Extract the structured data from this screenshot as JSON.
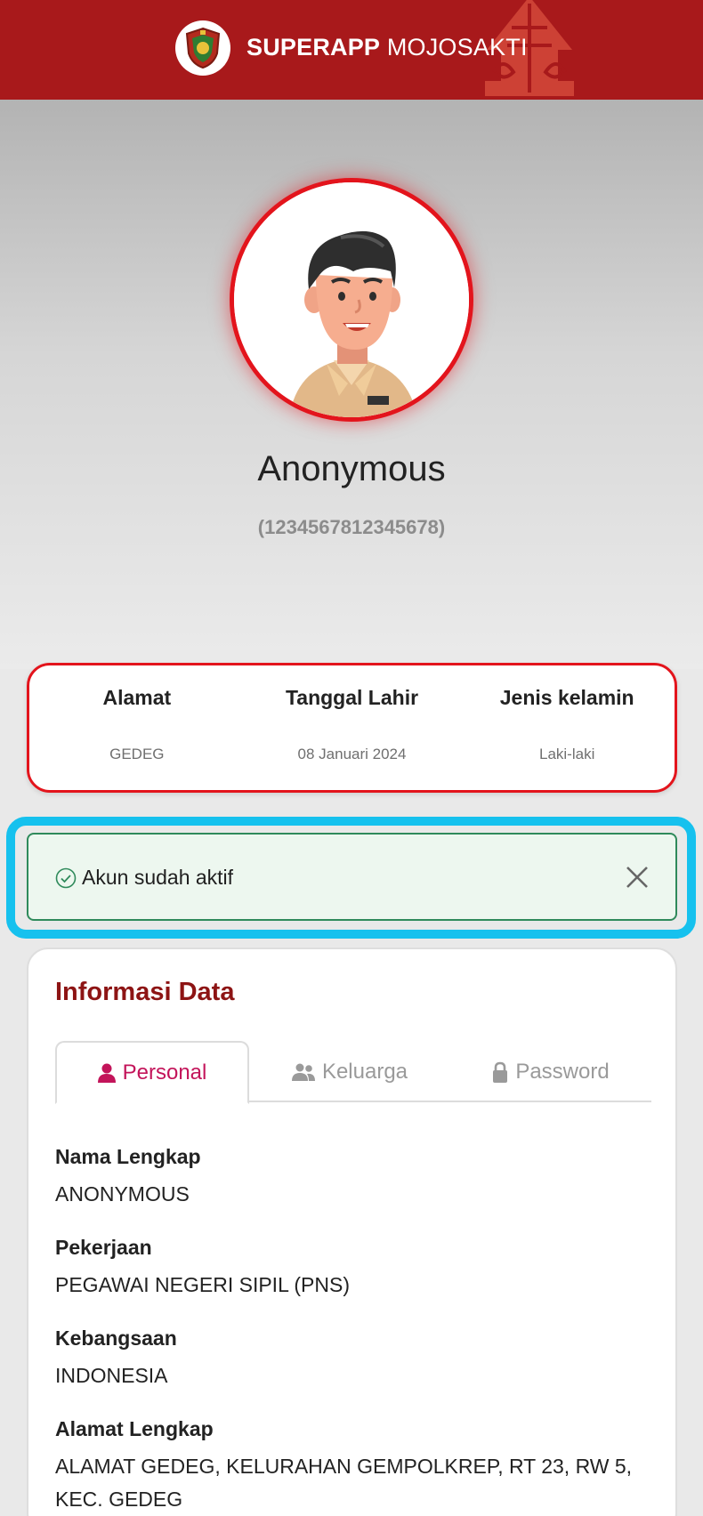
{
  "header": {
    "title_bold": "SUPERAPP",
    "title_rest": " MOJOSAKTI",
    "colors": {
      "background": "#a8191b",
      "ornament": "#d4483a"
    }
  },
  "profile": {
    "name": "Anonymous",
    "nip": "(1234567812345678)",
    "ring_color": "#e3141c"
  },
  "info": {
    "items": [
      {
        "label": "Alamat",
        "value": "GEDEG"
      },
      {
        "label": "Tanggal Lahir",
        "value": "08 Januari 2024"
      },
      {
        "label": "Jenis kelamin",
        "value": "Laki-laki"
      }
    ]
  },
  "alert": {
    "message": "Akun sudah aktif",
    "color": "#2f8a5b",
    "highlight_color": "#16c1ee"
  },
  "data_section": {
    "title": "Informasi Data",
    "tabs": [
      {
        "label": "Personal",
        "icon": "user-icon",
        "active": true
      },
      {
        "label": "Keluarga",
        "icon": "users-icon",
        "active": false
      },
      {
        "label": "Password",
        "icon": "lock-icon",
        "active": false
      }
    ],
    "fields": [
      {
        "label": "Nama Lengkap",
        "value": "ANONYMOUS"
      },
      {
        "label": "Pekerjaan",
        "value": "PEGAWAI NEGERI SIPIL (PNS)"
      },
      {
        "label": "Kebangsaan",
        "value": "INDONESIA"
      },
      {
        "label": "Alamat Lengkap",
        "value": "ALAMAT GEDEG, KELURAHAN GEMPOLKREP, RT 23, RW 5, KEC. GEDEG"
      }
    ]
  }
}
